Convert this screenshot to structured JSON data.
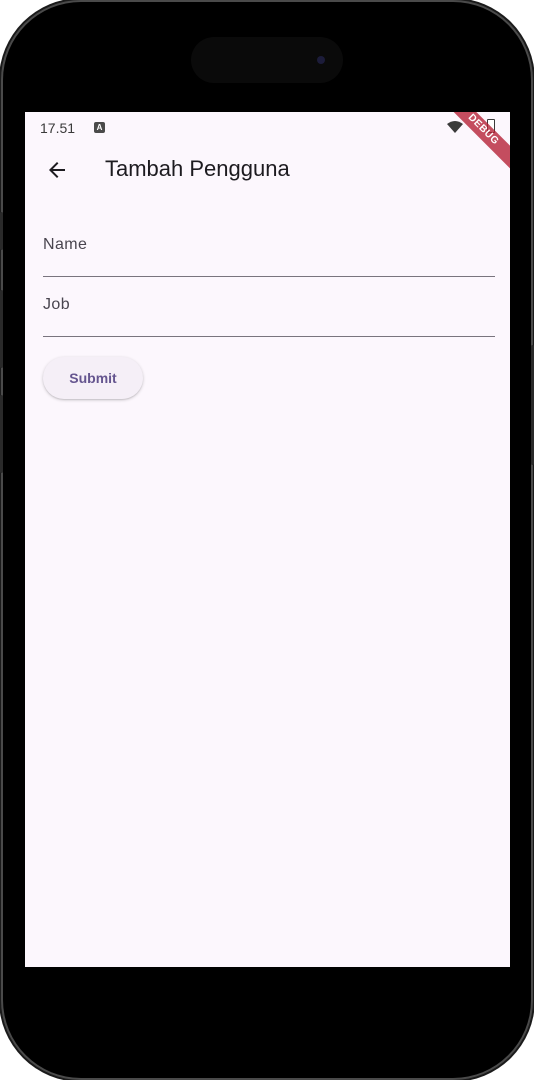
{
  "status_bar": {
    "time": "17.51",
    "notification_icon": "a-notification-icon",
    "wifi_icon": "wifi-icon",
    "battery_icon": "battery-icon"
  },
  "debug_banner": "DEBUG",
  "app_bar": {
    "back_icon": "arrow-back-icon",
    "title": "Tambah Pengguna"
  },
  "form": {
    "name_label": "Name",
    "name_value": "",
    "job_label": "Job",
    "job_value": "",
    "submit_label": "Submit"
  },
  "colors": {
    "background": "#fcf7fd",
    "primary": "#65558f",
    "debug_banner": "#b41e32"
  }
}
